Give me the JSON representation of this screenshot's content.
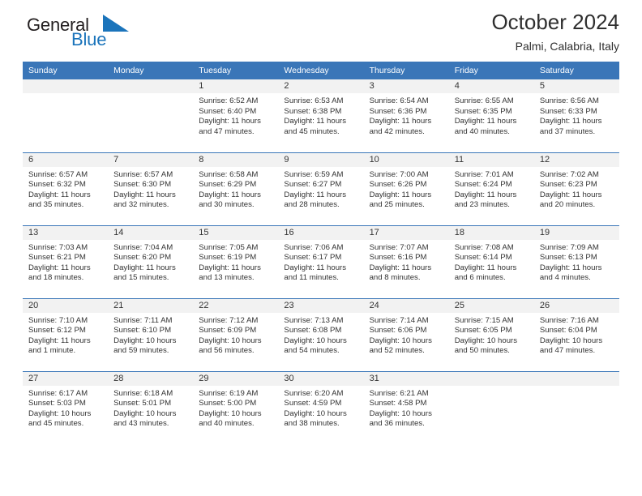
{
  "brand": {
    "name_top": "General",
    "name_bottom": "Blue",
    "flag_icon": "triangle-flag-icon",
    "color_top": "#231f20",
    "color_bottom": "#1b74bb"
  },
  "header": {
    "title": "October 2024",
    "subtitle": "Palmi, Calabria, Italy"
  },
  "theme": {
    "header_blue": "#3a76b8",
    "daynum_band": "#f2f2f2",
    "text": "#333333"
  },
  "calendar": {
    "weekday_headers": [
      "Sunday",
      "Monday",
      "Tuesday",
      "Wednesday",
      "Thursday",
      "Friday",
      "Saturday"
    ],
    "weeks": [
      [
        {
          "day": "",
          "lines": []
        },
        {
          "day": "",
          "lines": []
        },
        {
          "day": "1",
          "lines": [
            "Sunrise: 6:52 AM",
            "Sunset: 6:40 PM",
            "Daylight: 11 hours",
            "and 47 minutes."
          ]
        },
        {
          "day": "2",
          "lines": [
            "Sunrise: 6:53 AM",
            "Sunset: 6:38 PM",
            "Daylight: 11 hours",
            "and 45 minutes."
          ]
        },
        {
          "day": "3",
          "lines": [
            "Sunrise: 6:54 AM",
            "Sunset: 6:36 PM",
            "Daylight: 11 hours",
            "and 42 minutes."
          ]
        },
        {
          "day": "4",
          "lines": [
            "Sunrise: 6:55 AM",
            "Sunset: 6:35 PM",
            "Daylight: 11 hours",
            "and 40 minutes."
          ]
        },
        {
          "day": "5",
          "lines": [
            "Sunrise: 6:56 AM",
            "Sunset: 6:33 PM",
            "Daylight: 11 hours",
            "and 37 minutes."
          ]
        }
      ],
      [
        {
          "day": "6",
          "lines": [
            "Sunrise: 6:57 AM",
            "Sunset: 6:32 PM",
            "Daylight: 11 hours",
            "and 35 minutes."
          ]
        },
        {
          "day": "7",
          "lines": [
            "Sunrise: 6:57 AM",
            "Sunset: 6:30 PM",
            "Daylight: 11 hours",
            "and 32 minutes."
          ]
        },
        {
          "day": "8",
          "lines": [
            "Sunrise: 6:58 AM",
            "Sunset: 6:29 PM",
            "Daylight: 11 hours",
            "and 30 minutes."
          ]
        },
        {
          "day": "9",
          "lines": [
            "Sunrise: 6:59 AM",
            "Sunset: 6:27 PM",
            "Daylight: 11 hours",
            "and 28 minutes."
          ]
        },
        {
          "day": "10",
          "lines": [
            "Sunrise: 7:00 AM",
            "Sunset: 6:26 PM",
            "Daylight: 11 hours",
            "and 25 minutes."
          ]
        },
        {
          "day": "11",
          "lines": [
            "Sunrise: 7:01 AM",
            "Sunset: 6:24 PM",
            "Daylight: 11 hours",
            "and 23 minutes."
          ]
        },
        {
          "day": "12",
          "lines": [
            "Sunrise: 7:02 AM",
            "Sunset: 6:23 PM",
            "Daylight: 11 hours",
            "and 20 minutes."
          ]
        }
      ],
      [
        {
          "day": "13",
          "lines": [
            "Sunrise: 7:03 AM",
            "Sunset: 6:21 PM",
            "Daylight: 11 hours",
            "and 18 minutes."
          ]
        },
        {
          "day": "14",
          "lines": [
            "Sunrise: 7:04 AM",
            "Sunset: 6:20 PM",
            "Daylight: 11 hours",
            "and 15 minutes."
          ]
        },
        {
          "day": "15",
          "lines": [
            "Sunrise: 7:05 AM",
            "Sunset: 6:19 PM",
            "Daylight: 11 hours",
            "and 13 minutes."
          ]
        },
        {
          "day": "16",
          "lines": [
            "Sunrise: 7:06 AM",
            "Sunset: 6:17 PM",
            "Daylight: 11 hours",
            "and 11 minutes."
          ]
        },
        {
          "day": "17",
          "lines": [
            "Sunrise: 7:07 AM",
            "Sunset: 6:16 PM",
            "Daylight: 11 hours",
            "and 8 minutes."
          ]
        },
        {
          "day": "18",
          "lines": [
            "Sunrise: 7:08 AM",
            "Sunset: 6:14 PM",
            "Daylight: 11 hours",
            "and 6 minutes."
          ]
        },
        {
          "day": "19",
          "lines": [
            "Sunrise: 7:09 AM",
            "Sunset: 6:13 PM",
            "Daylight: 11 hours",
            "and 4 minutes."
          ]
        }
      ],
      [
        {
          "day": "20",
          "lines": [
            "Sunrise: 7:10 AM",
            "Sunset: 6:12 PM",
            "Daylight: 11 hours",
            "and 1 minute."
          ]
        },
        {
          "day": "21",
          "lines": [
            "Sunrise: 7:11 AM",
            "Sunset: 6:10 PM",
            "Daylight: 10 hours",
            "and 59 minutes."
          ]
        },
        {
          "day": "22",
          "lines": [
            "Sunrise: 7:12 AM",
            "Sunset: 6:09 PM",
            "Daylight: 10 hours",
            "and 56 minutes."
          ]
        },
        {
          "day": "23",
          "lines": [
            "Sunrise: 7:13 AM",
            "Sunset: 6:08 PM",
            "Daylight: 10 hours",
            "and 54 minutes."
          ]
        },
        {
          "day": "24",
          "lines": [
            "Sunrise: 7:14 AM",
            "Sunset: 6:06 PM",
            "Daylight: 10 hours",
            "and 52 minutes."
          ]
        },
        {
          "day": "25",
          "lines": [
            "Sunrise: 7:15 AM",
            "Sunset: 6:05 PM",
            "Daylight: 10 hours",
            "and 50 minutes."
          ]
        },
        {
          "day": "26",
          "lines": [
            "Sunrise: 7:16 AM",
            "Sunset: 6:04 PM",
            "Daylight: 10 hours",
            "and 47 minutes."
          ]
        }
      ],
      [
        {
          "day": "27",
          "lines": [
            "Sunrise: 6:17 AM",
            "Sunset: 5:03 PM",
            "Daylight: 10 hours",
            "and 45 minutes."
          ]
        },
        {
          "day": "28",
          "lines": [
            "Sunrise: 6:18 AM",
            "Sunset: 5:01 PM",
            "Daylight: 10 hours",
            "and 43 minutes."
          ]
        },
        {
          "day": "29",
          "lines": [
            "Sunrise: 6:19 AM",
            "Sunset: 5:00 PM",
            "Daylight: 10 hours",
            "and 40 minutes."
          ]
        },
        {
          "day": "30",
          "lines": [
            "Sunrise: 6:20 AM",
            "Sunset: 4:59 PM",
            "Daylight: 10 hours",
            "and 38 minutes."
          ]
        },
        {
          "day": "31",
          "lines": [
            "Sunrise: 6:21 AM",
            "Sunset: 4:58 PM",
            "Daylight: 10 hours",
            "and 36 minutes."
          ]
        },
        {
          "day": "",
          "lines": []
        },
        {
          "day": "",
          "lines": []
        }
      ]
    ]
  }
}
